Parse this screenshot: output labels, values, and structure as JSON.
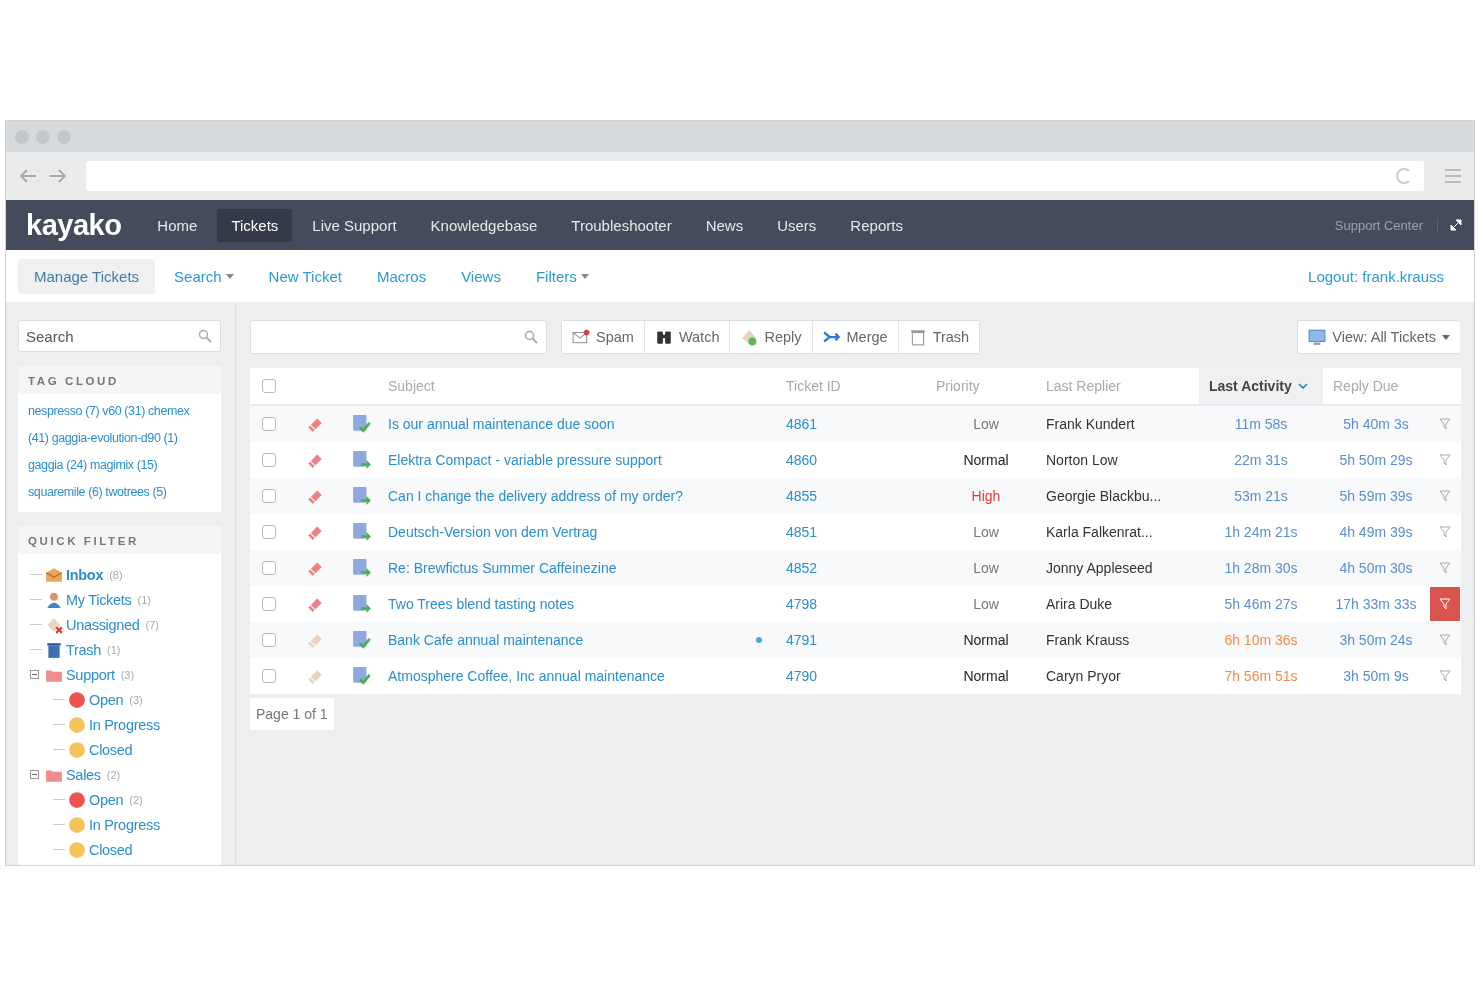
{
  "nav": {
    "logo": "kayako",
    "items": [
      {
        "label": "Home",
        "selected": false
      },
      {
        "label": "Tickets",
        "selected": true
      },
      {
        "label": "Live Support",
        "selected": false
      },
      {
        "label": "Knowledgebase",
        "selected": false
      },
      {
        "label": "Troubleshooter",
        "selected": false
      },
      {
        "label": "News",
        "selected": false
      },
      {
        "label": "Users",
        "selected": false
      },
      {
        "label": "Reports",
        "selected": false
      }
    ],
    "right": "Support Center"
  },
  "subnav": {
    "items": [
      {
        "label": "Manage Tickets",
        "selected": true,
        "dropdown": false
      },
      {
        "label": "Search",
        "selected": false,
        "dropdown": true
      },
      {
        "label": "New Ticket",
        "selected": false,
        "dropdown": false
      },
      {
        "label": "Macros",
        "selected": false,
        "dropdown": false
      },
      {
        "label": "Views",
        "selected": false,
        "dropdown": false
      },
      {
        "label": "Filters",
        "selected": false,
        "dropdown": true
      }
    ],
    "logout": "Logout: frank.krauss"
  },
  "sidebar": {
    "search": {
      "placeholder": "Search"
    },
    "tag_cloud": {
      "title": "TAG CLOUD",
      "lines": [
        "nespresso (7) v60 (31) chemex",
        "(41) gaggia-evolution-d90 (1)",
        "gaggia (24) magimix (15)",
        "squaremile (6) twotrees (5)"
      ]
    },
    "quick_filter": {
      "title": "QUICK FILTER",
      "items": [
        {
          "label": "Inbox",
          "count": "(8)",
          "kind": "inbox",
          "selected": true
        },
        {
          "label": "My Tickets",
          "count": "(1)",
          "kind": "user",
          "selected": false
        },
        {
          "label": "Unassigned",
          "count": "(7)",
          "kind": "unassigned",
          "selected": false
        },
        {
          "label": "Trash",
          "count": "(1)",
          "kind": "trash",
          "selected": false
        },
        {
          "label": "Support",
          "count": "(3)",
          "kind": "folder",
          "selected": false,
          "expanded": true,
          "children": [
            {
              "label": "Open",
              "count": "(3)",
              "kind": "open",
              "selected": false
            },
            {
              "label": "In Progress",
              "kind": "progress",
              "selected": false
            },
            {
              "label": "Closed",
              "kind": "closed",
              "selected": false
            }
          ]
        },
        {
          "label": "Sales",
          "count": "(2)",
          "kind": "folder",
          "selected": false,
          "expanded": true,
          "children": [
            {
              "label": "Open",
              "count": "(2)",
              "kind": "open",
              "selected": false
            },
            {
              "label": "In Progress",
              "kind": "progress",
              "selected": false
            },
            {
              "label": "Closed",
              "kind": "closed",
              "selected": false
            }
          ]
        }
      ]
    }
  },
  "toolbar": {
    "buttons": [
      {
        "label": "Spam",
        "kind": "spam"
      },
      {
        "label": "Watch",
        "kind": "watch"
      },
      {
        "label": "Reply",
        "kind": "reply"
      },
      {
        "label": "Merge",
        "kind": "merge"
      },
      {
        "label": "Trash",
        "kind": "trash"
      }
    ],
    "view": "View: All Tickets"
  },
  "table": {
    "select_all": {
      "checked": false
    },
    "columns": [
      {
        "label": "Subject",
        "sorted": false
      },
      {
        "label": "Ticket ID",
        "sorted": false
      },
      {
        "label": "Priority",
        "sorted": false
      },
      {
        "label": "Last Replier",
        "sorted": false
      },
      {
        "label": "Last Activity",
        "sorted": true
      },
      {
        "label": "Reply Due",
        "sorted": false
      }
    ],
    "rows": [
      {
        "subject": "Is our annual maintenance due soon",
        "id": "4861",
        "checked": false,
        "priority": {
          "text": "Low",
          "color": "#777777"
        },
        "replier": "Frank Kundert",
        "last_activity": "11m 58s",
        "overdue": false,
        "reply_due": "5h 40m 3s",
        "flagged": false,
        "new": false,
        "kind": "check",
        "tag_faded": false
      },
      {
        "subject": "Elektra Compact - variable pressure support",
        "id": "4860",
        "checked": false,
        "priority": {
          "text": "Normal",
          "color": "#222222"
        },
        "replier": "Norton Low",
        "last_activity": "22m 31s",
        "overdue": false,
        "reply_due": "5h 50m 29s",
        "flagged": false,
        "new": false,
        "kind": "arrow",
        "tag_faded": false
      },
      {
        "subject": "Can I change the delivery address of my order?",
        "id": "4855",
        "checked": false,
        "priority": {
          "text": "High",
          "color": "#e53935"
        },
        "replier": "Georgie Blackbu...",
        "last_activity": "53m 21s",
        "overdue": false,
        "reply_due": "5h 59m 39s",
        "flagged": false,
        "new": false,
        "kind": "arrow",
        "tag_faded": false
      },
      {
        "subject": "Deutsch-Version von dem Vertrag",
        "id": "4851",
        "checked": false,
        "priority": {
          "text": "Low",
          "color": "#777777"
        },
        "replier": "Karla Falkenrat...",
        "last_activity": "1h 24m 21s",
        "overdue": false,
        "reply_due": "4h 49m 39s",
        "flagged": false,
        "new": false,
        "kind": "arrow",
        "tag_faded": false
      },
      {
        "subject": "Re: Brewfictus Summer Caffeinezine",
        "id": "4852",
        "checked": false,
        "priority": {
          "text": "Low",
          "color": "#777777"
        },
        "replier": "Jonny Appleseed",
        "last_activity": "1h 28m 30s",
        "overdue": false,
        "reply_due": "4h 50m 30s",
        "flagged": false,
        "new": false,
        "kind": "arrow",
        "tag_faded": false
      },
      {
        "subject": "Two Trees blend tasting notes",
        "id": "4798",
        "checked": false,
        "priority": {
          "text": "Low",
          "color": "#777777"
        },
        "replier": "Arira Duke",
        "last_activity": "5h 46m 27s",
        "overdue": false,
        "reply_due": "17h 33m 33s",
        "flagged": true,
        "new": false,
        "kind": "arrow",
        "tag_faded": false
      },
      {
        "subject": "Bank Cafe annual maintenance",
        "id": "4791",
        "checked": false,
        "priority": {
          "text": "Normal",
          "color": "#222222"
        },
        "replier": "Frank Krauss",
        "last_activity": "6h 10m 36s",
        "overdue": true,
        "reply_due": "3h 50m 24s",
        "flagged": false,
        "new": true,
        "kind": "check",
        "tag_faded": true
      },
      {
        "subject": "Atmosphere Coffee, Inc annual maintenance",
        "id": "4790",
        "checked": false,
        "priority": {
          "text": "Normal",
          "color": "#222222"
        },
        "replier": "Caryn Pryor",
        "last_activity": "7h 56m 51s",
        "overdue": true,
        "reply_due": "3h 50m 9s",
        "flagged": false,
        "new": false,
        "kind": "check",
        "tag_faded": true
      }
    ]
  },
  "pagination": "Page 1 of 1"
}
